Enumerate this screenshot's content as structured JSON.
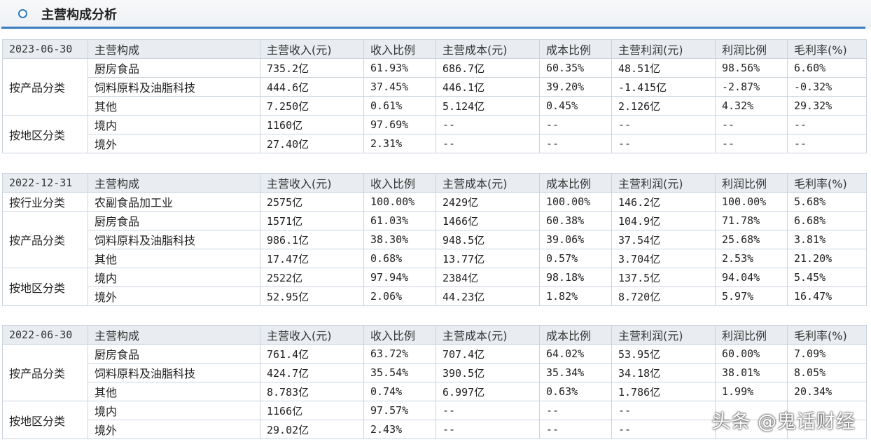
{
  "title": "主营构成分析",
  "headers": [
    "主营构成",
    "主营收入(元)",
    "收入比例",
    "主营成本(元)",
    "成本比例",
    "主营利润(元)",
    "利润比例",
    "毛利率(%)"
  ],
  "periods": [
    {
      "date": "2023-06-30",
      "groups": [
        {
          "label": "按产品分类",
          "rows": [
            [
              "厨房食品",
              "735.2亿",
              "61.93%",
              "686.7亿",
              "60.35%",
              "48.51亿",
              "98.56%",
              "6.60%"
            ],
            [
              "饲料原料及油脂科技",
              "444.6亿",
              "37.45%",
              "446.1亿",
              "39.20%",
              "-1.415亿",
              "-2.87%",
              "-0.32%"
            ],
            [
              "其他",
              "7.250亿",
              "0.61%",
              "5.124亿",
              "0.45%",
              "2.126亿",
              "4.32%",
              "29.32%"
            ]
          ]
        },
        {
          "label": "按地区分类",
          "rows": [
            [
              "境内",
              "1160亿",
              "97.69%",
              "--",
              "--",
              "--",
              "--",
              "--"
            ],
            [
              "境外",
              "27.40亿",
              "2.31%",
              "--",
              "--",
              "--",
              "--",
              "--"
            ]
          ]
        }
      ]
    },
    {
      "date": "2022-12-31",
      "groups": [
        {
          "label": "按行业分类",
          "rows": [
            [
              "农副食品加工业",
              "2575亿",
              "100.00%",
              "2429亿",
              "100.00%",
              "146.2亿",
              "100.00%",
              "5.68%"
            ]
          ]
        },
        {
          "label": "按产品分类",
          "rows": [
            [
              "厨房食品",
              "1571亿",
              "61.03%",
              "1466亿",
              "60.38%",
              "104.9亿",
              "71.78%",
              "6.68%"
            ],
            [
              "饲料原料及油脂科技",
              "986.1亿",
              "38.30%",
              "948.5亿",
              "39.06%",
              "37.54亿",
              "25.68%",
              "3.81%"
            ],
            [
              "其他",
              "17.47亿",
              "0.68%",
              "13.77亿",
              "0.57%",
              "3.704亿",
              "2.53%",
              "21.20%"
            ]
          ]
        },
        {
          "label": "按地区分类",
          "rows": [
            [
              "境内",
              "2522亿",
              "97.94%",
              "2384亿",
              "98.18%",
              "137.5亿",
              "94.04%",
              "5.45%"
            ],
            [
              "境外",
              "52.95亿",
              "2.06%",
              "44.23亿",
              "1.82%",
              "8.720亿",
              "5.97%",
              "16.47%"
            ]
          ]
        }
      ]
    },
    {
      "date": "2022-06-30",
      "groups": [
        {
          "label": "按产品分类",
          "rows": [
            [
              "厨房食品",
              "761.4亿",
              "63.72%",
              "707.4亿",
              "64.02%",
              "53.95亿",
              "60.00%",
              "7.09%"
            ],
            [
              "饲料原料及油脂科技",
              "424.7亿",
              "35.54%",
              "390.5亿",
              "35.34%",
              "34.18亿",
              "38.01%",
              "8.05%"
            ],
            [
              "其他",
              "8.783亿",
              "0.74%",
              "6.997亿",
              "0.63%",
              "1.786亿",
              "1.99%",
              "20.34%"
            ]
          ]
        },
        {
          "label": "按地区分类",
          "rows": [
            [
              "境内",
              "1166亿",
              "97.57%",
              "--",
              "--",
              "--",
              "",
              ""
            ],
            [
              "境外",
              "29.02亿",
              "2.43%",
              "--",
              "--",
              "--",
              "",
              ""
            ]
          ]
        }
      ]
    }
  ],
  "watermark": "头条 @鬼话财经"
}
